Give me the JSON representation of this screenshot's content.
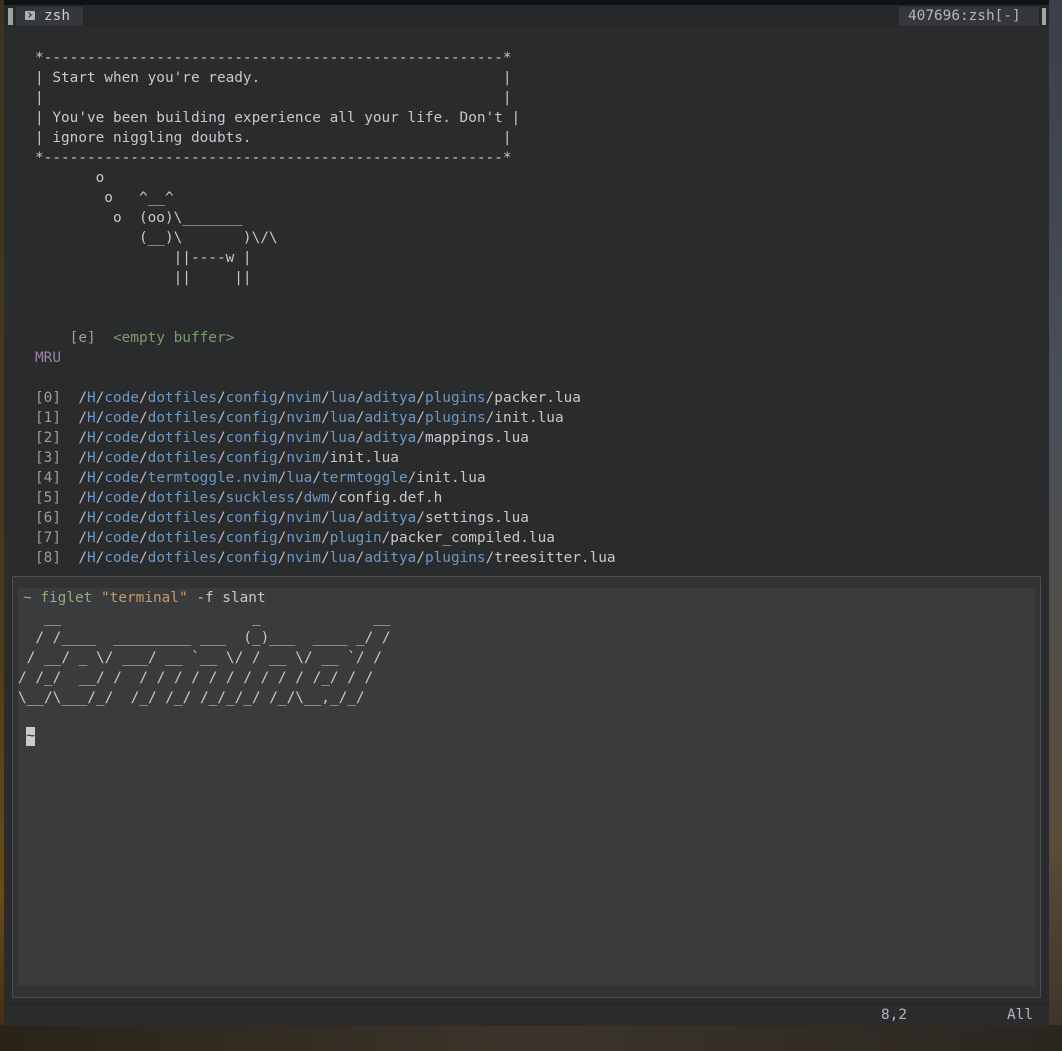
{
  "tabline": {
    "tab_label": "zsh",
    "session": "407696:zsh[-]"
  },
  "cowsay": {
    "box_top": "*-----------------------------------------------------*",
    "lines": [
      "| Start when you're ready.                            |",
      "|                                                     |",
      "| You've been building experience all your life. Don't |",
      "| ignore niggling doubts.                             |"
    ],
    "box_bottom": "*-----------------------------------------------------*",
    "cow": [
      "       o",
      "        o   ^__^",
      "         o  (oo)\\_______",
      "            (__)\\       )\\/\\",
      "                ||----w |",
      "                ||     ||"
    ]
  },
  "startify": {
    "empty_key": "[e]",
    "empty_label": "<empty buffer>",
    "mru_header": "MRU",
    "mru": [
      {
        "key": "[0]",
        "parts": [
          "H",
          "code",
          "dotfiles",
          "config",
          "nvim",
          "lua",
          "aditya",
          "plugins"
        ],
        "file": "packer.lua"
      },
      {
        "key": "[1]",
        "parts": [
          "H",
          "code",
          "dotfiles",
          "config",
          "nvim",
          "lua",
          "aditya",
          "plugins"
        ],
        "file": "init.lua"
      },
      {
        "key": "[2]",
        "parts": [
          "H",
          "code",
          "dotfiles",
          "config",
          "nvim",
          "lua",
          "aditya"
        ],
        "file": "mappings.lua"
      },
      {
        "key": "[3]",
        "parts": [
          "H",
          "code",
          "dotfiles",
          "config",
          "nvim"
        ],
        "file": "init.lua"
      },
      {
        "key": "[4]",
        "parts": [
          "H",
          "code",
          "termtoggle.nvim",
          "lua",
          "termtoggle"
        ],
        "file": "init.lua"
      },
      {
        "key": "[5]",
        "parts": [
          "H",
          "code",
          "dotfiles",
          "suckless",
          "dwm"
        ],
        "file": "config.def.h"
      },
      {
        "key": "[6]",
        "parts": [
          "H",
          "code",
          "dotfiles",
          "config",
          "nvim",
          "lua",
          "aditya"
        ],
        "file": "settings.lua"
      },
      {
        "key": "[7]",
        "parts": [
          "H",
          "code",
          "dotfiles",
          "config",
          "nvim",
          "plugin"
        ],
        "file": "packer_compiled.lua"
      },
      {
        "key": "[8]",
        "parts": [
          "H",
          "code",
          "dotfiles",
          "config",
          "nvim",
          "lua",
          "aditya",
          "plugins"
        ],
        "file": "treesitter.lua"
      }
    ]
  },
  "terminal": {
    "prompt": "~",
    "command": "figlet",
    "arg": "\"terminal\"",
    "flags": "-f slant",
    "figlet": [
      "   __                      _             __",
      "  / /____  _________ ___  (_)___  ____ _/ /",
      " / __/ _ \\/ ___/ __ `__ \\/ / __ \\/ __ `/ /",
      "/ /_/  __/ /  / / / / / / / / / / /_/ / /",
      "\\__/\\___/_/  /_/ /_/ /_/_/_/ /_/\\__,_/_/"
    ],
    "cursor_char": "~"
  },
  "statusline": {
    "position": "8,2",
    "scroll": "All"
  }
}
